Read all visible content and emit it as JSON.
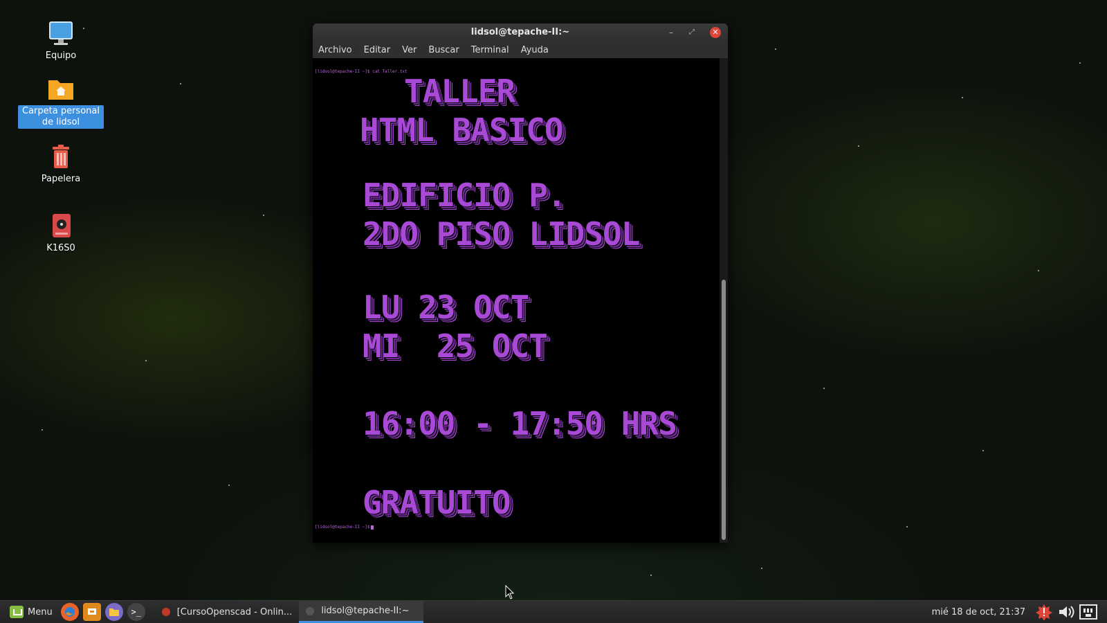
{
  "desktop": {
    "icons": [
      {
        "label": "Equipo"
      },
      {
        "label": "Carpeta personal de lidsol"
      },
      {
        "label": "Papelera"
      },
      {
        "label": "K16S0"
      }
    ]
  },
  "terminal": {
    "title": "lidsol@tepache-II:~",
    "menu": [
      "Archivo",
      "Editar",
      "Ver",
      "Buscar",
      "Terminal",
      "Ayuda"
    ],
    "command_line": "[lidsol@tepache-II ~]$ cat Taller.txt",
    "banner": {
      "taller": "TALLER",
      "html": "HTML BASICO",
      "edificio": "EDIFICIO P.",
      "piso": "2DO PISO LIDSOL",
      "lunes": "LU 23 OCT",
      "miercoles": "MI  25 OCT",
      "horario": "16:00 - 17:50 HRS",
      "gratuito": "GRATUITO"
    },
    "final_prompt": "[lidsol@tepache-II ~]$",
    "text_color": "#a84ad6"
  },
  "taskbar": {
    "menu_label": "Menu",
    "tasks": [
      {
        "label": "[CursoOpenscad - Onlin..."
      },
      {
        "label": "lidsol@tepache-II:~"
      }
    ],
    "clock": "mié 18 de oct, 21:37",
    "accent": "#3d8fe0"
  }
}
